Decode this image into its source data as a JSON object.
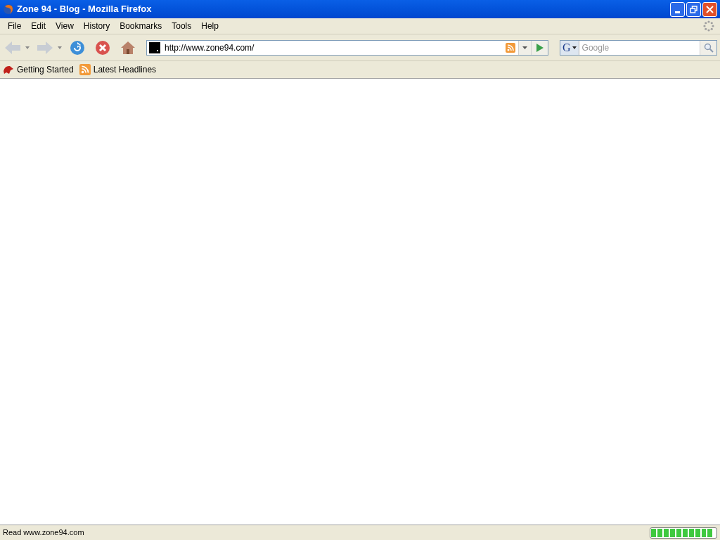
{
  "window": {
    "title": "Zone 94 - Blog - Mozilla Firefox"
  },
  "menu": [
    "File",
    "Edit",
    "View",
    "History",
    "Bookmarks",
    "Tools",
    "Help"
  ],
  "navigation": {
    "back_disabled": true,
    "forward_disabled": true,
    "url": "http://www.zone94.com/"
  },
  "search": {
    "engine_label": "G",
    "placeholder": "Google"
  },
  "bookmarks": [
    {
      "label": "Getting Started",
      "kind": "page"
    },
    {
      "label": "Latest Headlines",
      "kind": "feed"
    }
  ],
  "status_bar": {
    "text": "Read www.zone94.com",
    "level": 0.95
  }
}
